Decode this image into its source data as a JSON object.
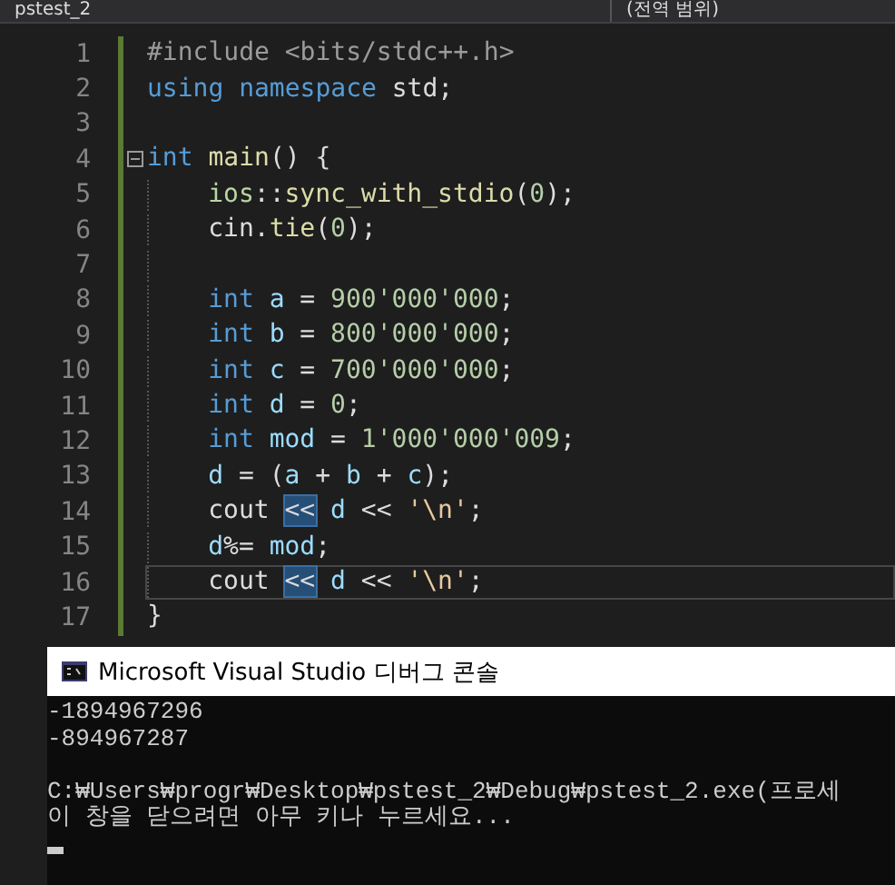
{
  "navigation_bar": {
    "project": "pstest_2",
    "scope": "(전역 범위)"
  },
  "editor": {
    "lines": [
      {
        "number": "1",
        "current": false,
        "tokens": [
          {
            "text": "#include <bits/stdc++.h>",
            "kind": "macro"
          }
        ]
      },
      {
        "number": "2",
        "current": false,
        "tokens": [
          {
            "text": "using namespace ",
            "kind": "keyword"
          },
          {
            "text": "std;",
            "kind": "plain"
          }
        ]
      },
      {
        "number": "3",
        "current": false
      },
      {
        "number": "4",
        "current": false,
        "expanded": true,
        "tokens": [
          {
            "text": "int ",
            "kind": "keyword"
          },
          {
            "text": "main",
            "kind": "function"
          },
          {
            "text": "() {",
            "kind": "plain"
          }
        ],
        "children": [
          {
            "number": "5",
            "current": false,
            "tokens": [
              {
                "text": "ios",
                "kind": "type"
              },
              {
                "text": "::",
                "kind": "plain"
              },
              {
                "text": "sync_with_stdio",
                "kind": "function"
              },
              {
                "text": "(",
                "kind": "plain"
              },
              {
                "text": "0",
                "kind": "number"
              },
              {
                "text": ");",
                "kind": "plain"
              }
            ]
          },
          {
            "number": "6",
            "current": false,
            "tokens": [
              {
                "text": "cin.",
                "kind": "plain"
              },
              {
                "text": "tie",
                "kind": "function"
              },
              {
                "text": "(",
                "kind": "plain"
              },
              {
                "text": "0",
                "kind": "number"
              },
              {
                "text": ");",
                "kind": "plain"
              }
            ]
          },
          {
            "number": "7",
            "current": false
          },
          {
            "number": "8",
            "current": false,
            "tokens": [
              {
                "text": "int ",
                "kind": "keyword"
              },
              {
                "text": "a",
                "kind": "variable"
              },
              {
                "text": " = ",
                "kind": "plain"
              },
              {
                "text": "900'000'000",
                "kind": "number"
              },
              {
                "text": ";",
                "kind": "plain"
              }
            ]
          },
          {
            "number": "9",
            "current": false,
            "tokens": [
              {
                "text": "int ",
                "kind": "keyword"
              },
              {
                "text": "b",
                "kind": "variable"
              },
              {
                "text": " = ",
                "kind": "plain"
              },
              {
                "text": "800'000'000",
                "kind": "number"
              },
              {
                "text": ";",
                "kind": "plain"
              }
            ]
          },
          {
            "number": "10",
            "current": false,
            "tokens": [
              {
                "text": "int ",
                "kind": "keyword"
              },
              {
                "text": "c",
                "kind": "variable"
              },
              {
                "text": " = ",
                "kind": "plain"
              },
              {
                "text": "700'000'000",
                "kind": "number"
              },
              {
                "text": ";",
                "kind": "plain"
              }
            ]
          },
          {
            "number": "11",
            "current": false,
            "tokens": [
              {
                "text": "int ",
                "kind": "keyword"
              },
              {
                "text": "d",
                "kind": "variable"
              },
              {
                "text": " = ",
                "kind": "plain"
              },
              {
                "text": "0",
                "kind": "number"
              },
              {
                "text": ";",
                "kind": "plain"
              }
            ]
          },
          {
            "number": "12",
            "current": false,
            "tokens": [
              {
                "text": "int ",
                "kind": "keyword"
              },
              {
                "text": "mod",
                "kind": "variable"
              },
              {
                "text": " = ",
                "kind": "plain"
              },
              {
                "text": "1'000'000'009",
                "kind": "number"
              },
              {
                "text": ";",
                "kind": "plain"
              }
            ]
          },
          {
            "number": "13",
            "current": false,
            "tokens": [
              {
                "text": "d",
                "kind": "variable"
              },
              {
                "text": " = (",
                "kind": "plain"
              },
              {
                "text": "a",
                "kind": "variable"
              },
              {
                "text": " + ",
                "kind": "plain"
              },
              {
                "text": "b",
                "kind": "variable"
              },
              {
                "text": " + ",
                "kind": "plain"
              },
              {
                "text": "c",
                "kind": "variable"
              },
              {
                "text": ");",
                "kind": "plain"
              }
            ]
          },
          {
            "number": "14",
            "current": false,
            "tokens": [
              {
                "text": "cout ",
                "kind": "plain"
              },
              {
                "text": "<<",
                "kind": "match"
              },
              {
                "text": " d",
                "kind": "variable"
              },
              {
                "text": " << ",
                "kind": "plain"
              },
              {
                "text": "'\\n'",
                "kind": "string"
              },
              {
                "text": ";",
                "kind": "plain"
              }
            ]
          },
          {
            "number": "15",
            "current": false,
            "tokens": [
              {
                "text": "d",
                "kind": "variable"
              },
              {
                "text": "%= ",
                "kind": "plain"
              },
              {
                "text": "mod",
                "kind": "variable"
              },
              {
                "text": ";",
                "kind": "plain"
              }
            ]
          },
          {
            "number": "16",
            "current": true,
            "tokens": [
              {
                "text": "cout ",
                "kind": "plain"
              },
              {
                "text": "<<",
                "kind": "match"
              },
              {
                "text": " d",
                "kind": "variable"
              },
              {
                "text": " << ",
                "kind": "plain"
              },
              {
                "text": "'\\n'",
                "kind": "string"
              },
              {
                "text": ";",
                "kind": "plain"
              }
            ]
          }
        ]
      },
      {
        "number": "17",
        "current": false,
        "tokens": [
          {
            "text": "}",
            "kind": "plain"
          }
        ]
      }
    ]
  },
  "console": {
    "title": "Microsoft Visual Studio 디버그 콘솔",
    "output": [
      "-1894967296",
      "-894967287"
    ],
    "messages": [
      "C:₩Users₩progr₩Desktop₩pstest_2₩Debug₩pstest_2.exe(프로세",
      "이 창을 닫으려면 아무 키나 누르세요..."
    ]
  }
}
